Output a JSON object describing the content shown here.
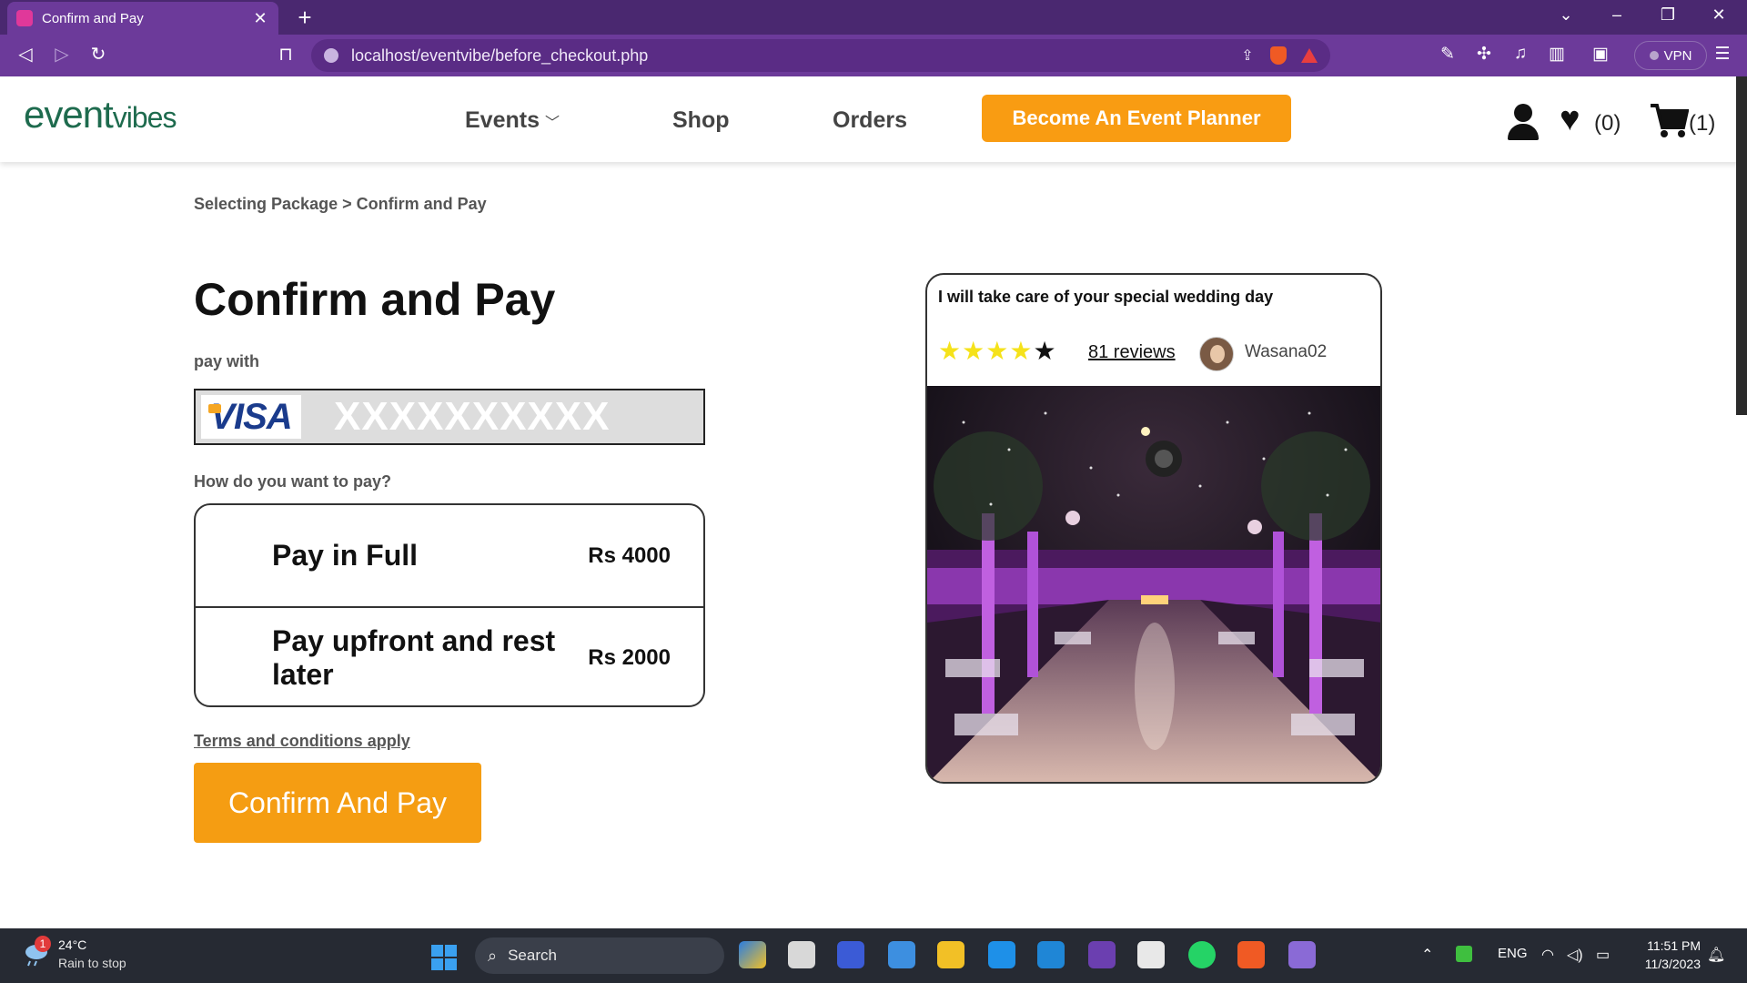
{
  "browser": {
    "tab_title": "Confirm and Pay",
    "tab_close": "✕",
    "new_tab": "+",
    "url": "localhost/eventvibe/before_checkout.php",
    "vpn_label": "VPN"
  },
  "site": {
    "logo_main": "event",
    "logo_sub": "vibes",
    "nav": {
      "events": "Events",
      "shop": "Shop",
      "orders": "Orders",
      "cta": "Become An Event Planner"
    },
    "wishlist_count": "(0)",
    "cart_count": "(1)"
  },
  "breadcrumb": "Selecting Package > Confirm and Pay",
  "page_title": "Confirm and Pay",
  "pay_with_label": "pay with",
  "card": {
    "brand": "VISA",
    "number": "XXXXXXXXXX"
  },
  "how_to_pay_label": "How do you want to pay?",
  "payment_options": [
    {
      "label": "Pay in Full",
      "price": "Rs 4000"
    },
    {
      "label": "Pay upfront and rest later",
      "price": "Rs 2000"
    }
  ],
  "terms": "Terms and conditions apply",
  "confirm_button": "Confirm And Pay",
  "package": {
    "title": "I will take care of your special wedding day",
    "rating": 4,
    "max_rating": 5,
    "reviews": "81 reviews",
    "seller": "Wasana02"
  },
  "taskbar": {
    "weather_temp": "24°C",
    "weather_desc": "Rain to stop",
    "weather_badge": "1",
    "search_label": "Search",
    "language": "ENG",
    "time": "11:51 PM",
    "date": "11/3/2023"
  },
  "colors": {
    "browser_tab_bg": "#4a2870",
    "browser_toolbar": "#6c3a9a",
    "brand_green": "#1e6b4e",
    "accent_orange": "#f99c12",
    "star_yellow": "#f5e21a"
  }
}
